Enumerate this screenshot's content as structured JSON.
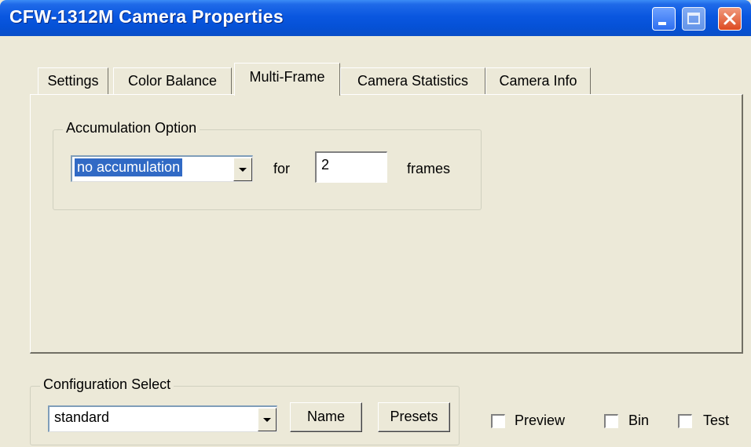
{
  "window": {
    "title": "CFW-1312M Camera Properties"
  },
  "tabs": [
    {
      "label": "Settings",
      "active": false
    },
    {
      "label": "Color Balance",
      "active": false
    },
    {
      "label": "Multi-Frame",
      "active": true
    },
    {
      "label": "Camera Statistics",
      "active": false
    },
    {
      "label": "Camera Info",
      "active": false
    }
  ],
  "accumulation": {
    "legend": "Accumulation Option",
    "mode_value": "no accumulation",
    "for_label": "for",
    "frames_value": "2",
    "frames_label": "frames"
  },
  "configuration": {
    "legend": "Configuration Select",
    "value": "standard",
    "name_button": "Name",
    "presets_button": "Presets"
  },
  "options": {
    "preview_label": "Preview",
    "bin_label": "Bin",
    "test_label": "Test",
    "preview_checked": false,
    "bin_checked": false,
    "test_checked": false
  },
  "colors": {
    "title_blue": "#0a57e0",
    "face": "#ece9d8",
    "close_red": "#dd4a21",
    "selection": "#316ac5"
  }
}
